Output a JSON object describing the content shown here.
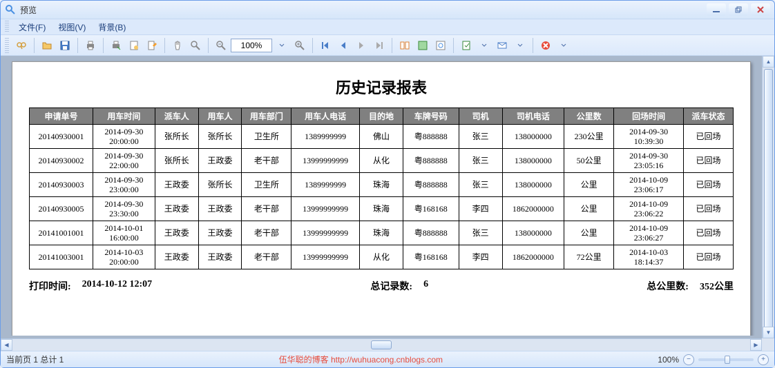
{
  "window": {
    "title": "预览"
  },
  "menu": {
    "file": "文件(F)",
    "view": "视图(V)",
    "background": "背景(B)"
  },
  "toolbar": {
    "zoom_value": "100%"
  },
  "report": {
    "title": "历史记录报表",
    "columns": [
      "申请单号",
      "用车时间",
      "派车人",
      "用车人",
      "用车部门",
      "用车人电话",
      "目的地",
      "车牌号码",
      "司机",
      "司机电话",
      "公里数",
      "回场时间",
      "派车状态"
    ],
    "rows": [
      [
        "20140930001",
        "2014-09-30\n20:00:00",
        "张所长",
        "张所长",
        "卫生所",
        "1389999999",
        "佛山",
        "粤888888",
        "张三",
        "138000000",
        "230公里",
        "2014-09-30\n10:39:30",
        "已回场"
      ],
      [
        "20140930002",
        "2014-09-30\n22:00:00",
        "张所长",
        "王政委",
        "老干部",
        "13999999999",
        "从化",
        "粤888888",
        "张三",
        "138000000",
        "50公里",
        "2014-09-30\n23:05:16",
        "已回场"
      ],
      [
        "20140930003",
        "2014-09-30\n23:00:00",
        "王政委",
        "张所长",
        "卫生所",
        "1389999999",
        "珠海",
        "粤888888",
        "张三",
        "138000000",
        "公里",
        "2014-10-09\n23:06:17",
        "已回场"
      ],
      [
        "20140930005",
        "2014-09-30\n23:30:00",
        "王政委",
        "王政委",
        "老干部",
        "13999999999",
        "珠海",
        "粤168168",
        "李四",
        "1862000000",
        "公里",
        "2014-10-09\n23:06:22",
        "已回场"
      ],
      [
        "20141001001",
        "2014-10-01\n16:00:00",
        "王政委",
        "王政委",
        "老干部",
        "13999999999",
        "珠海",
        "粤888888",
        "张三",
        "138000000",
        "公里",
        "2014-10-09\n23:06:27",
        "已回场"
      ],
      [
        "20141003001",
        "2014-10-03\n20:00:00",
        "王政委",
        "王政委",
        "老干部",
        "13999999999",
        "从化",
        "粤168168",
        "李四",
        "1862000000",
        "72公里",
        "2014-10-03\n18:14:37",
        "已回场"
      ]
    ],
    "print_label": "打印时间:",
    "print_time": "2014-10-12 12:07",
    "total_records_label": "总记录数:",
    "total_records": "6",
    "total_km_label": "总公里数:",
    "total_km": "352公里"
  },
  "status": {
    "page_info": "当前页 1 总计 1",
    "watermark": "伍华聪的博客 http://wuhuacong.cnblogs.com",
    "zoom": "100%"
  }
}
